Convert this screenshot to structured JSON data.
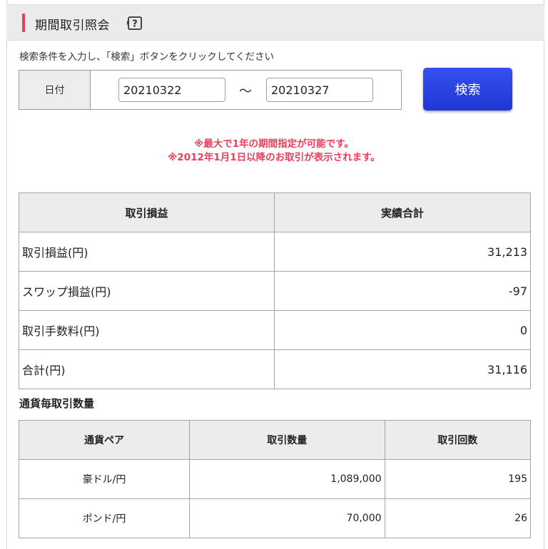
{
  "header": {
    "title": "期間取引照会",
    "help_icon": "question-mark-icon"
  },
  "search": {
    "instruction": "検索条件を入力し、「検索」ボタンをクリックしてください",
    "date_label": "日付",
    "date_from": "20210322",
    "tilde": "～",
    "date_to": "20210327",
    "button_label": "検索",
    "button_color": "#2a44e0"
  },
  "notes": [
    "※最大で1年の期間指定が可能です。",
    "※2012年1月1日以降のお取引が表示されます。"
  ],
  "note_color": "#e8405a",
  "pl_table": {
    "headers": [
      "取引損益",
      "実績合計"
    ],
    "rows": [
      {
        "label": "取引損益(円)",
        "value": "31,213"
      },
      {
        "label": "スワップ損益(円)",
        "value": "-97"
      },
      {
        "label": "取引手数料(円)",
        "value": "0"
      },
      {
        "label": "合計(円)",
        "value": "31,116"
      }
    ]
  },
  "currency_section": {
    "title": "通貨毎取引数量",
    "headers": [
      "通貨ペア",
      "取引数量",
      "取引回数"
    ],
    "rows": [
      {
        "pair": "豪ドル/円",
        "quantity": "1,089,000",
        "count": "195"
      },
      {
        "pair": "ポンド/円",
        "quantity": "70,000",
        "count": "26"
      }
    ]
  }
}
